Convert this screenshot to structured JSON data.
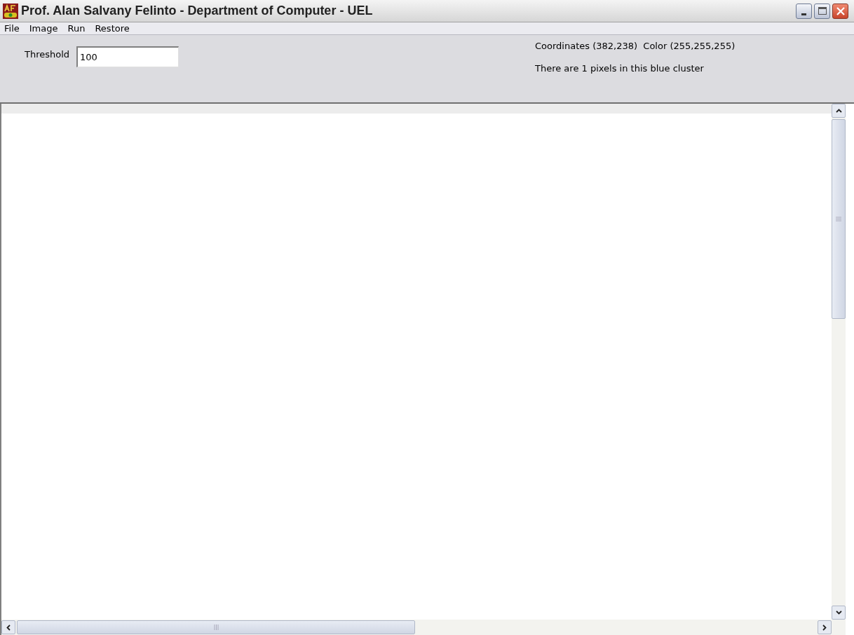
{
  "window": {
    "title": "Prof. Alan Salvany Felinto - Department of Computer - UEL"
  },
  "menu": [
    {
      "label": "File"
    },
    {
      "label": "Image"
    },
    {
      "label": "Run"
    },
    {
      "label": "Restore"
    }
  ],
  "toolbar": {
    "threshold_label": "Threshold",
    "threshold_value": "100",
    "coordinates": "Coordinates (382,238)  Color (255,255,255)",
    "cluster_info": "There are 1 pixels in this blue cluster"
  }
}
